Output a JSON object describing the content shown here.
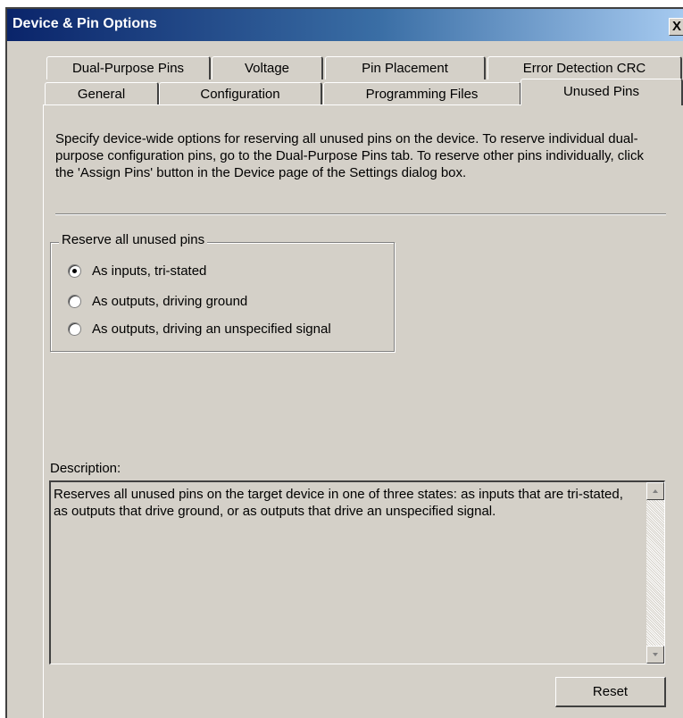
{
  "window": {
    "title": "Device & Pin Options",
    "close_glyph": "X"
  },
  "tabs_row1": [
    {
      "label": "Dual-Purpose Pins"
    },
    {
      "label": "Voltage"
    },
    {
      "label": "Pin Placement"
    },
    {
      "label": "Error Detection CRC"
    }
  ],
  "tabs_row2": [
    {
      "label": "General"
    },
    {
      "label": "Configuration"
    },
    {
      "label": "Programming Files"
    },
    {
      "label": "Unused Pins",
      "active": true
    }
  ],
  "intro_text": "Specify device-wide options for reserving all unused pins on the device.  To reserve individual dual-purpose configuration pins, go to the Dual-Purpose Pins tab.  To reserve other pins individually, click the 'Assign Pins' button in the Device page of the Settings dialog box.",
  "reserve_group": {
    "title": "Reserve all unused pins",
    "options": [
      {
        "label": "As inputs, tri-stated",
        "selected": true
      },
      {
        "label": "As outputs, driving ground",
        "selected": false
      },
      {
        "label": "As outputs, driving an unspecified signal",
        "selected": false
      }
    ]
  },
  "description": {
    "label": "Description:",
    "text": "Reserves all unused pins on the target device in one of three states: as inputs that are tri-stated, as outputs that drive ground, or as outputs that drive an unspecified signal."
  },
  "reset_label": "Reset",
  "colors": {
    "titlebar_start": "#0a246a",
    "titlebar_end": "#a6caf0",
    "face": "#d4d0c8"
  }
}
